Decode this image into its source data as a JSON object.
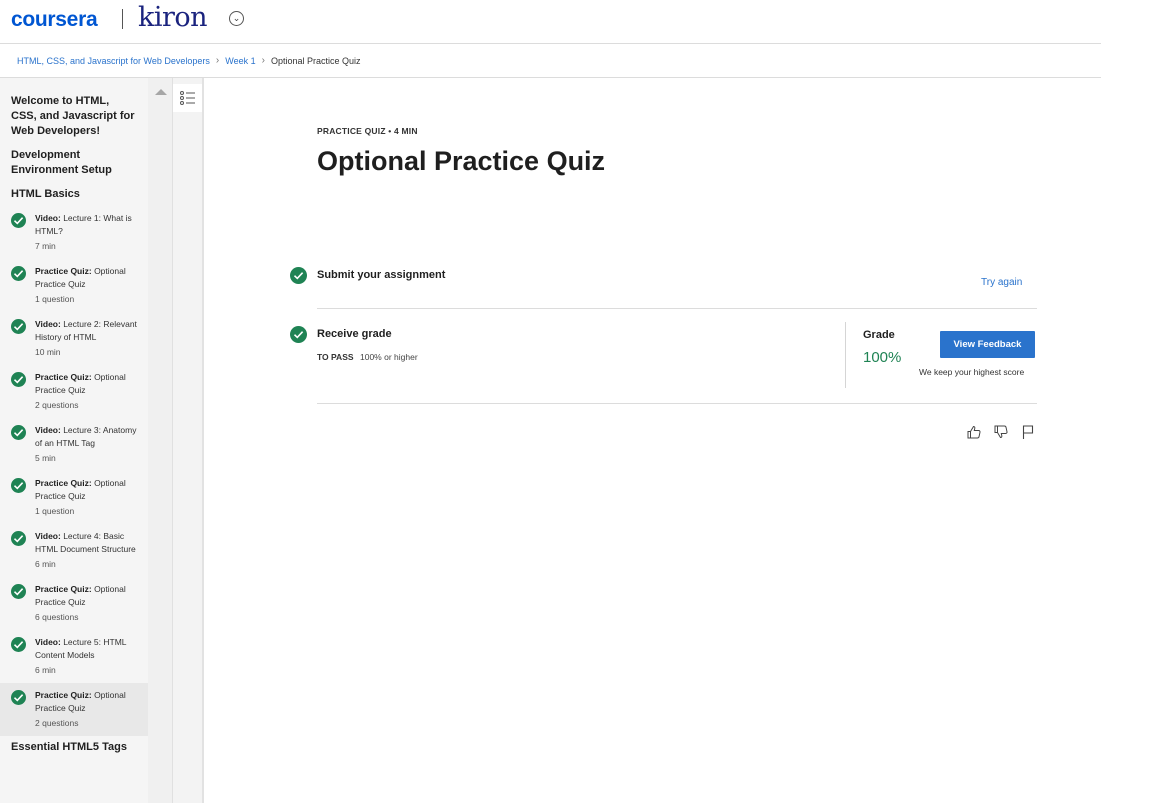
{
  "header": {
    "brand": "coursera",
    "partner": "kiron",
    "partner_menu_icon": "chevron-down-icon"
  },
  "breadcrumb": {
    "course": "HTML, CSS, and Javascript for Web Developers",
    "week": "Week 1",
    "current": "Optional Practice Quiz",
    "separator": ">"
  },
  "sidebar": {
    "sections": [
      "Welcome to HTML, CSS, and Javascript for Web Developers!",
      "Development Environment Setup",
      "HTML Basics",
      "Essential HTML5 Tags"
    ],
    "items": [
      {
        "kind": "Video:",
        "title": "Lecture 1: What is HTML?",
        "meta": "7 min"
      },
      {
        "kind": "Practice Quiz:",
        "title": "Optional Practice Quiz",
        "meta": "1 question"
      },
      {
        "kind": "Video:",
        "title": "Lecture 2: Relevant History of HTML",
        "meta": "10 min"
      },
      {
        "kind": "Practice Quiz:",
        "title": "Optional Practice Quiz",
        "meta": "2 questions"
      },
      {
        "kind": "Video:",
        "title": "Lecture 3: Anatomy of an HTML Tag",
        "meta": "5 min"
      },
      {
        "kind": "Practice Quiz:",
        "title": "Optional Practice Quiz",
        "meta": "1 question"
      },
      {
        "kind": "Video:",
        "title": "Lecture 4: Basic HTML Document Structure",
        "meta": "6 min"
      },
      {
        "kind": "Practice Quiz:",
        "title": "Optional Practice Quiz",
        "meta": "6 questions"
      },
      {
        "kind": "Video:",
        "title": "Lecture 5: HTML Content Models",
        "meta": "6 min"
      },
      {
        "kind": "Practice Quiz:",
        "title": "Optional Practice Quiz",
        "meta": "2 questions"
      }
    ],
    "active_index": 9
  },
  "main": {
    "eyebrow": "PRACTICE QUIZ • 4 MIN",
    "title": "Optional Practice Quiz",
    "submit": {
      "title": "Submit your assignment",
      "action": "Try again"
    },
    "receive": {
      "title": "Receive grade",
      "pass_label": "TO PASS",
      "pass_value": "100% or higher",
      "grade_label": "Grade",
      "grade_value": "100%",
      "button": "View Feedback",
      "note": "We keep your highest score"
    },
    "feedback_icons": [
      "thumbs-up-icon",
      "thumbs-down-icon",
      "flag-icon"
    ]
  },
  "colors": {
    "brand_blue": "#0056d2",
    "link_blue": "#2a73cc",
    "success_green": "#1f8354",
    "kiron_navy": "#1a237e"
  }
}
